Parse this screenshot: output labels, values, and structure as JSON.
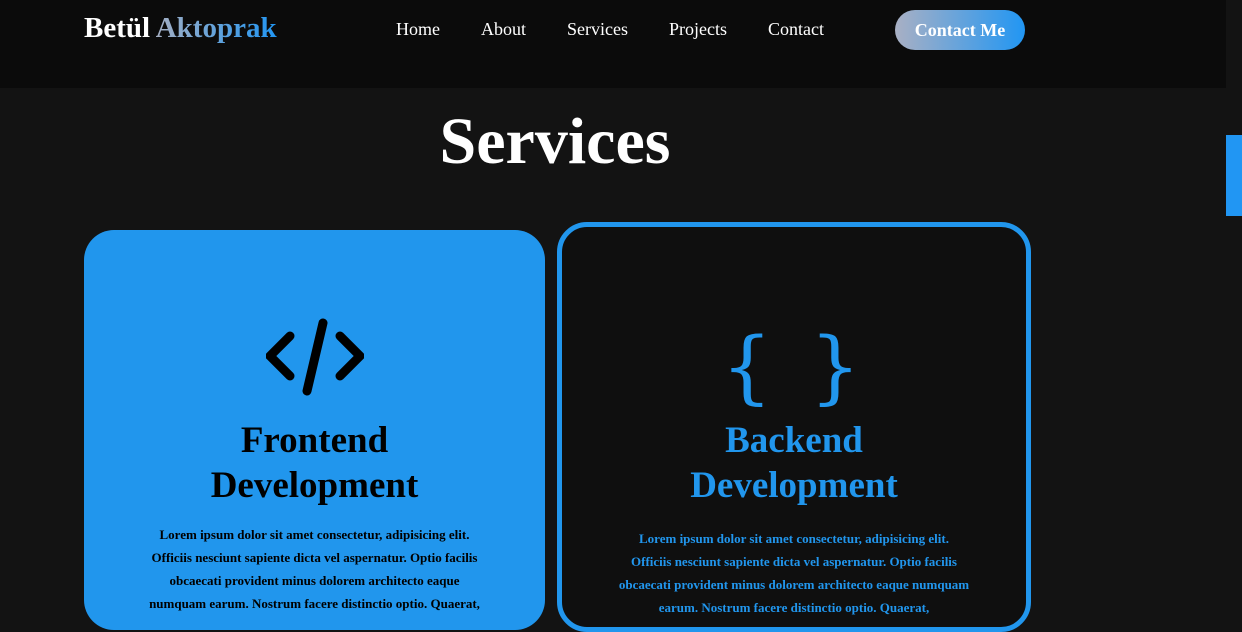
{
  "header": {
    "logo_first": "Betül",
    "logo_last": "Aktoprak",
    "nav": [
      "Home",
      "About",
      "Services",
      "Projects",
      "Contact"
    ],
    "cta_label": "Contact Me"
  },
  "section": {
    "title": "Services"
  },
  "cards": [
    {
      "icon": "code-icon",
      "title_line1": "Frontend",
      "title_line2": "Development",
      "text": "Lorem ipsum dolor sit amet consectetur, adipisicing elit. Officiis nesciunt sapiente dicta vel aspernatur. Optio facilis obcaecati provident minus dolorem architecto eaque numquam earum. Nostrum facere distinctio optio. Quaerat,"
    },
    {
      "icon": "curly-braces-icon",
      "icon_glyph": "{ }",
      "title_line1": "Backend",
      "title_line2": "Development",
      "text": "Lorem ipsum dolor sit amet consectetur, adipisicing elit. Officiis nesciunt sapiente dicta vel aspernatur. Optio facilis obcaecati provident minus dolorem architecto eaque numquam earum. Nostrum facere distinctio optio. Quaerat,"
    }
  ],
  "colors": {
    "accent": "#2196ed",
    "background": "#131313",
    "header_background": "#0b0b0b"
  }
}
